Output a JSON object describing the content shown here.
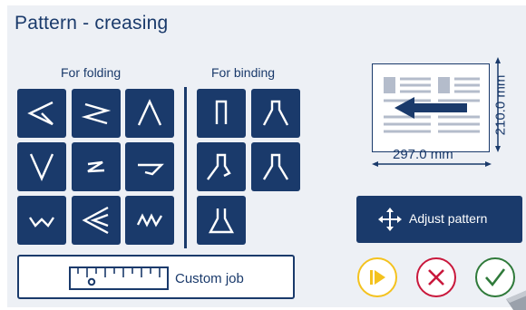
{
  "title": "Pattern - creasing",
  "sections": {
    "folding_label": "For folding",
    "binding_label": "For binding"
  },
  "folding_patterns": [
    {
      "icon": "fold-left-chevron-icon"
    },
    {
      "icon": "fold-zigzag-icon"
    },
    {
      "icon": "fold-peak-icon"
    },
    {
      "icon": "fold-v-icon"
    },
    {
      "icon": "fold-z-icon"
    },
    {
      "icon": "fold-gate-icon"
    },
    {
      "icon": "fold-w-icon"
    },
    {
      "icon": "fold-double-chevron-icon"
    },
    {
      "icon": "fold-accordion-icon"
    }
  ],
  "binding_patterns": [
    {
      "icon": "bind-spine-icon"
    },
    {
      "icon": "bind-flare-icon"
    },
    {
      "icon": "bind-flare-wide-icon"
    },
    {
      "icon": "bind-flare-open-icon"
    },
    {
      "icon": "bind-flare-base-icon"
    }
  ],
  "custom_job": {
    "label": "Custom job"
  },
  "preview": {
    "width_label": "297.0 mm",
    "height_label": "210.0 mm"
  },
  "adjust": {
    "label": "Adjust pattern"
  },
  "colors": {
    "accent": "#1a3a6b",
    "panel": "#edf0f5",
    "play": "#f4c21e",
    "cancel": "#c9183c",
    "confirm": "#2f7a3a"
  }
}
